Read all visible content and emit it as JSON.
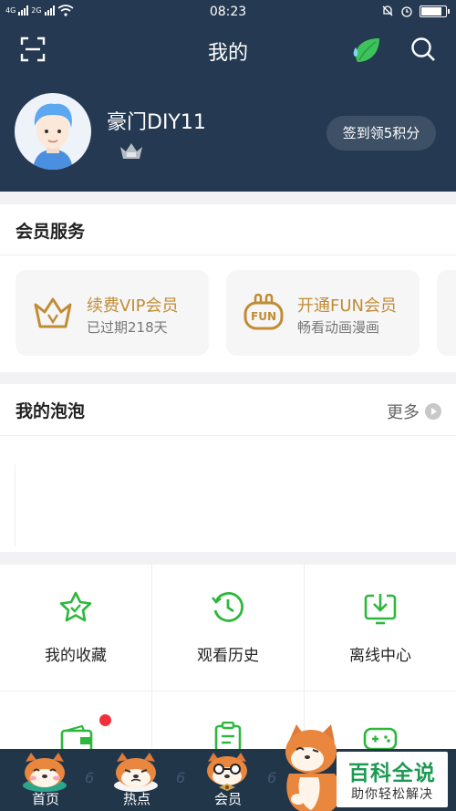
{
  "status_bar": {
    "time": "08:23",
    "network_1": "4G",
    "network_2": "2G"
  },
  "header": {
    "title": "我的",
    "icons": [
      "scan-icon",
      "leaf-icon",
      "search-icon"
    ]
  },
  "profile": {
    "username": "豪门DIY11",
    "signin_button": "签到领5积分"
  },
  "member_services": {
    "title": "会员服务",
    "items": [
      {
        "title": "续费VIP会员",
        "subtitle": "已过期218天",
        "icon": "vip-crown-icon"
      },
      {
        "title": "开通FUN会员",
        "subtitle": "畅看动画漫画",
        "icon": "fun-icon"
      }
    ]
  },
  "bubbles": {
    "title": "我的泡泡",
    "more_label": "更多"
  },
  "grid": [
    {
      "label": "我的收藏",
      "icon": "star-collect-icon"
    },
    {
      "label": "观看历史",
      "icon": "history-clock-icon"
    },
    {
      "label": "离线中心",
      "icon": "download-icon"
    }
  ],
  "bottom_nav": {
    "tabs": [
      {
        "label": "首页",
        "num": "6"
      },
      {
        "label": "热点",
        "num": "6"
      },
      {
        "label": "会员",
        "num": "6"
      }
    ]
  },
  "watermark": {
    "title": "百科全说",
    "subtitle": "助你轻松解决"
  },
  "colors": {
    "header_bg": "#253a52",
    "accent_green": "#2db83d",
    "gold": "#c18c34"
  }
}
